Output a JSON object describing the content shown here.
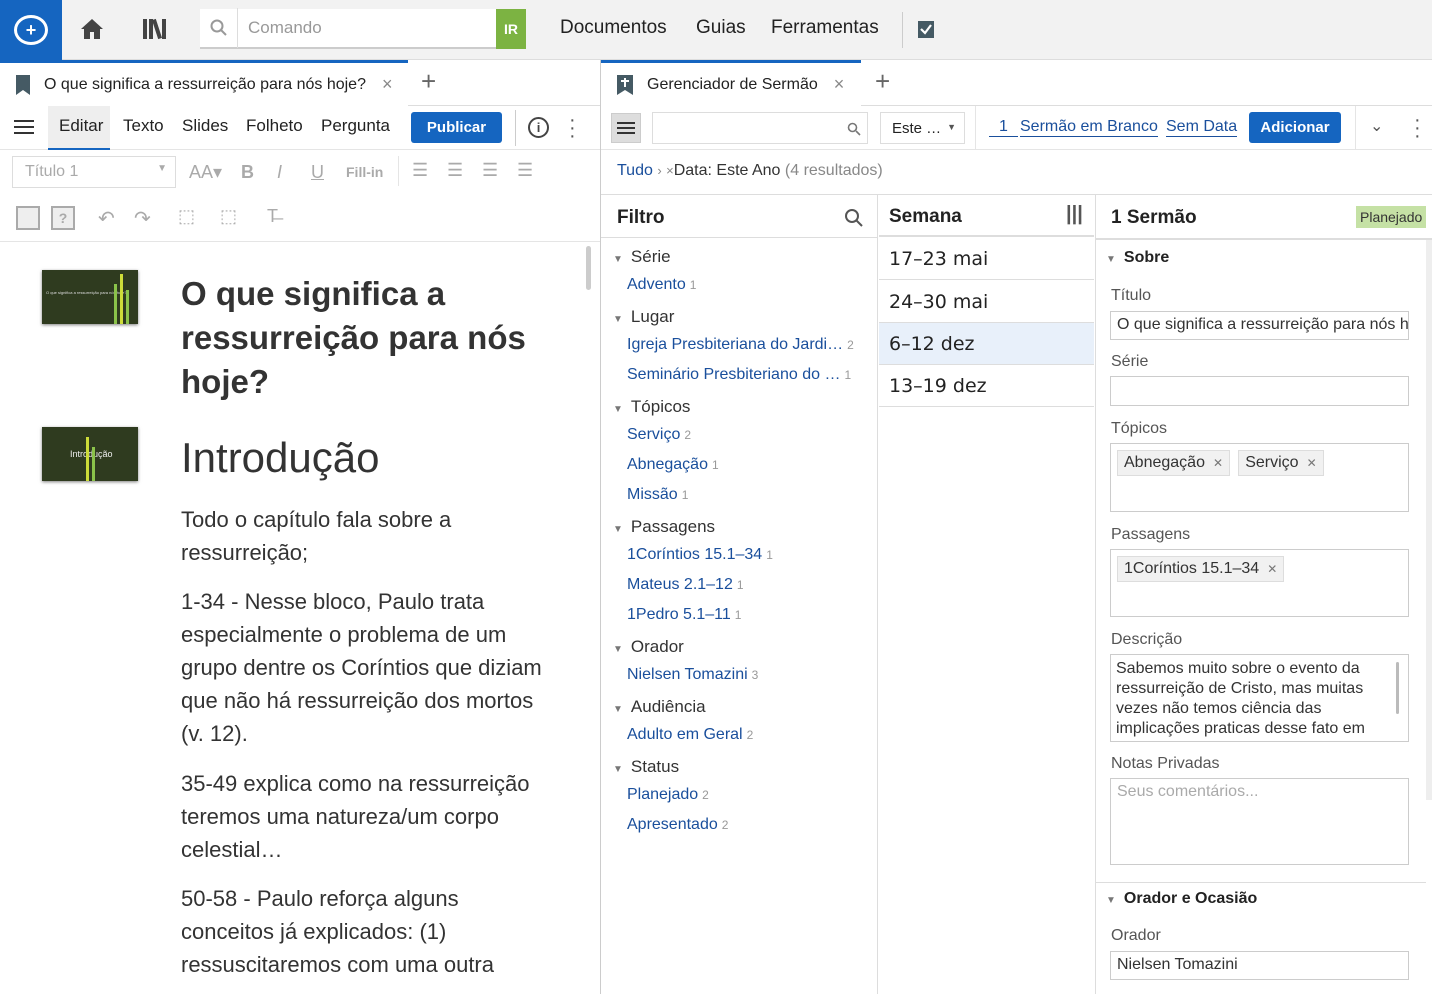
{
  "topbar": {
    "search_placeholder": "Comando",
    "go_label": "IR",
    "nav": [
      "Documentos",
      "Guias",
      "Ferramentas"
    ]
  },
  "left_tab": {
    "title": "O que significa a ressurreição para nós hoje?",
    "close": "×",
    "plus": "+"
  },
  "editor_toolbar": {
    "tabs": [
      "Editar",
      "Texto",
      "Slides",
      "Folheto",
      "Pergunta"
    ],
    "publish": "Publicar",
    "style_select": "Título 1",
    "fill_in": "Fill-in"
  },
  "document": {
    "title": "O que significa a ressurreição para nós hoje?",
    "heading": "Introdução",
    "paragraphs": [
      "Todo o capítulo fala sobre a ressurreição;",
      "1-34 - Nesse bloco, Paulo trata especialmente o problema de um grupo dentre os Coríntios que diziam que não há ressurreição dos mortos (v. 12).",
      "35-49 explica como na ressurreição teremos uma natureza/um corpo celestial…",
      "50-58 - Paulo reforça alguns conceitos já explicados: (1) ressuscitaremos com uma outra"
    ],
    "slide1_caption": "O que significa a ressurreição para nós hoje?",
    "slide2_caption": "Introdução"
  },
  "right_tab": {
    "title": "Gerenciador de Sermão",
    "close": "×",
    "plus": "+"
  },
  "manager_toolbar": {
    "filter_select": "Este …",
    "count": "1",
    "blank_sermon": "Sermão em Branco",
    "no_date": "Sem Data",
    "add": "Adicionar"
  },
  "breadcrumb": {
    "all": "Tudo",
    "sep": "›",
    "close": "×",
    "filter": "Data: Este Ano",
    "results": "(4 resultados)"
  },
  "filter": {
    "title": "Filtro",
    "groups": [
      {
        "name": "Série",
        "items": [
          {
            "label": "Advento",
            "count": "1"
          }
        ]
      },
      {
        "name": "Lugar",
        "items": [
          {
            "label": "Igreja Presbiteriana do Jardi…",
            "count": "2"
          },
          {
            "label": "Seminário Presbiteriano do …",
            "count": "1"
          }
        ]
      },
      {
        "name": "Tópicos",
        "items": [
          {
            "label": "Serviço",
            "count": "2"
          },
          {
            "label": "Abnegação",
            "count": "1"
          },
          {
            "label": "Missão",
            "count": "1"
          }
        ]
      },
      {
        "name": "Passagens",
        "items": [
          {
            "label": "1Coríntios 15.1–34",
            "count": "1"
          },
          {
            "label": "Mateus 2.1–12",
            "count": "1"
          },
          {
            "label": "1Pedro 5.1–11",
            "count": "1"
          }
        ]
      },
      {
        "name": "Orador",
        "items": [
          {
            "label": "Nielsen Tomazini",
            "count": "3"
          }
        ]
      },
      {
        "name": "Audiência",
        "items": [
          {
            "label": "Adulto em Geral",
            "count": "2"
          }
        ]
      },
      {
        "name": "Status",
        "items": [
          {
            "label": "Planejado",
            "count": "2"
          },
          {
            "label": "Apresentado",
            "count": "2"
          }
        ]
      }
    ]
  },
  "weeks": {
    "title": "Semana",
    "items": [
      "17–23 mai",
      "24–30 mai",
      "6–12 dez",
      "13–19 dez"
    ]
  },
  "detail": {
    "header": "1 Sermão",
    "status": "Planejado",
    "about": "Sobre",
    "title_label": "Título",
    "title_value": "O que significa a ressurreição para nós hoje?",
    "series_label": "Série",
    "topics_label": "Tópicos",
    "topics": [
      "Abnegação",
      "Serviço"
    ],
    "passages_label": "Passagens",
    "passages": [
      "1Coríntios 15.1–34"
    ],
    "desc_label": "Descrição",
    "desc_value": "Sabemos muito sobre o evento da ressurreição de Cristo, mas muitas vezes não temos ciência das implicações praticas desse fato em",
    "notes_label": "Notas Privadas",
    "notes_placeholder": "Seus comentários...",
    "speaker_section": "Orador e Ocasião",
    "speaker_label": "Orador",
    "speaker_value": "Nielsen Tomazini"
  },
  "colors": {
    "accent": "#1565c0",
    "link": "#1a4f9c",
    "go": "#7cb342",
    "status_badge": "#c5e1a5"
  }
}
